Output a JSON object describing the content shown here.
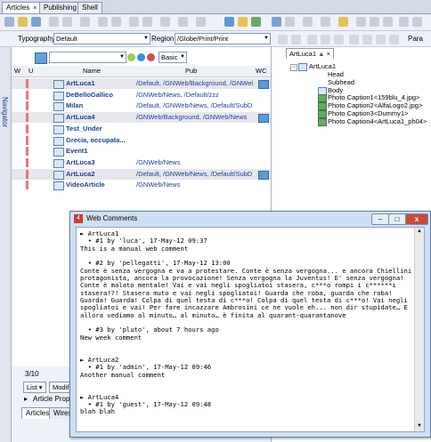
{
  "tabs": [
    {
      "label": "Articles",
      "close": "×"
    },
    {
      "label": "Publishing"
    },
    {
      "label": "Shell"
    }
  ],
  "filters": {
    "typography_label": "Typography",
    "typography_value": "Default",
    "region_label": "Region",
    "region_value": "/Globe/Print/Print",
    "para_label": "Para"
  },
  "navigator_label": "Navigator",
  "list_toolbar": {
    "mode_value": "Basic"
  },
  "columns": {
    "w": "W",
    "u": "U",
    "name": "Name",
    "pub": "Pub",
    "wc": "WC"
  },
  "articles": [
    {
      "name": "ArtLuca1",
      "pub": "/Default, /GNWeb/Background, /GNWel",
      "flag": true,
      "wc": true,
      "sel": true
    },
    {
      "name": "DeBelloGallico",
      "pub": "/GNWeb/News, /Default/zzz",
      "flag": true,
      "wc": false,
      "sel": false
    },
    {
      "name": "Milan",
      "pub": "/Default, /GNWeb/News, /Default/SubD",
      "flag": true,
      "wc": false,
      "sel": false
    },
    {
      "name": "ArtLuca4",
      "pub": "/GNWeb/Background, /GNWeb/News",
      "flag": true,
      "wc": true,
      "sel": true
    },
    {
      "name": "Test_Under",
      "pub": "",
      "flag": true,
      "wc": false,
      "sel": false
    },
    {
      "name": "Grecia, occupata...",
      "pub": "",
      "flag": true,
      "wc": false,
      "sel": false
    },
    {
      "name": "Event1",
      "pub": "",
      "flag": true,
      "wc": false,
      "sel": false
    },
    {
      "name": "ArtLuca3",
      "pub": "/GNWeb/News",
      "flag": true,
      "wc": false,
      "sel": false
    },
    {
      "name": "ArtLuca2",
      "pub": "/Default, /GNWeb/News, /Default/SubD",
      "flag": true,
      "wc": true,
      "sel": true
    },
    {
      "name": "VideoArticle",
      "pub": "/GNWeb/News",
      "flag": true,
      "wc": false,
      "sel": false
    }
  ],
  "status": {
    "count": "3/10",
    "list_button": "List",
    "modify_button": "Modif",
    "article_prop": "Article Prop"
  },
  "bottom_tabs": [
    "Articles",
    "Wires"
  ],
  "right_tab": "ArtLuca1",
  "tree": {
    "root": "ArtLuca1",
    "items": [
      "Head",
      "Subhead",
      "Body",
      "Photo Caption1<159blu_4.jpg>",
      "Photo Caption2<AlfaLogo2.jpg>",
      "Photo Caption3<Dummy1>",
      "Photo Caption4<ArtLuca1_ph04>"
    ]
  },
  "web_comments": {
    "title": "Web Comments",
    "text": "► ArtLuca1\n  • #1 by 'luca', 17-May-12 09:37\nThis is a manual web comment\n\n  • #2 by 'pellegatti', 17-May-12 13:00\nConte è senza vergogna e va a protestare. Conte è senza vergogna... e ancora Chiellini protagonista, ancora la provocazione! Senza vergogna la Juventus! E' senza vergogna! Conte è malato mentale! Vai e vai negli spogliatoi stasera, c***o rompi i c******i stasera!?! Stasera muto e vai negli spogliatoi! Guarda che roba, guarda che roba! Guarda! Guarda! Colpa di quel testa di c***o! Colpa di quel testa di c***o! Vai negli spogliatoi e vai! Per fare incazzare Ambrosini ce ne vuole eh... non dir stupidate… E allora vediamo al minuto… al minuto… è finita al quarant-quarantanove\n\n  • #3 by 'pluto', about 7 hours ago\nNew week comment\n\n\n► ArtLuca2\n  • #1 by 'admin', 17-May-12 09:46\nAnother manual comment\n\n\n► ArtLuca4\n  • #1 by 'guest', 17-May-12 09:48\nblah blah"
  },
  "colors": {
    "flag": "#e8767a",
    "link": "#1b3f9a",
    "titlebar": "#cfe0f4",
    "close": "#c74a3c"
  }
}
